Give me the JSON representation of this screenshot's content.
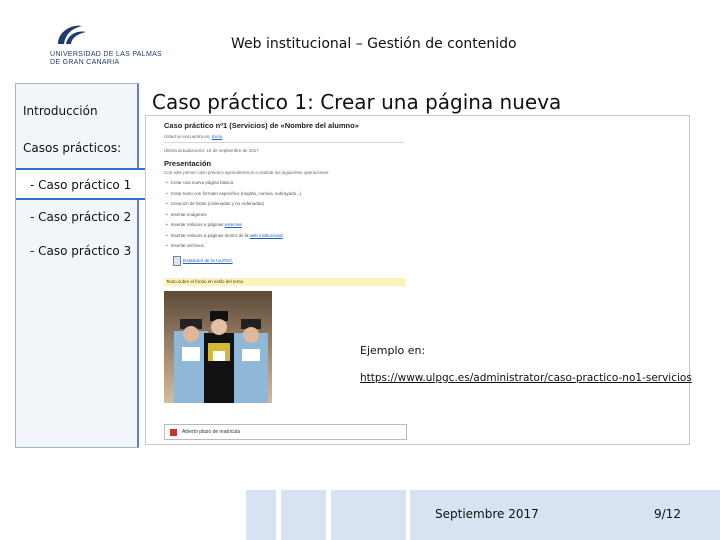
{
  "header": {
    "logo_lines": [
      "UNIVERSIDAD DE LAS PALMAS",
      "DE GRAN CANARIA"
    ],
    "title": "Web institucional – Gestión de contenido"
  },
  "sidebar": {
    "intro": "Introducción",
    "casos_header": "Casos prácticos:",
    "items": [
      {
        "label": "- Caso práctico 1",
        "active": true
      },
      {
        "label": "- Caso práctico 2",
        "active": false
      },
      {
        "label": "- Caso práctico 3",
        "active": false
      }
    ]
  },
  "slide": {
    "title": "Caso práctico 1: Crear una página nueva"
  },
  "screenshot": {
    "heading": "Caso práctico nº1 (Servicios) de «Nombre del alumno»",
    "meta_line1_prefix": "Usted se encuentra en: ",
    "meta_line1_link": "Inicio",
    "meta_line2": "Última actualización: 15 de septiembre de 2017",
    "presentation_heading": "Presentación",
    "presentation_intro": "Con este primer caso práctico aprenderemos a realizar las siguientes operaciones:",
    "list_items": [
      {
        "text": "Crear una nueva página básica",
        "link": ""
      },
      {
        "text": "Crear texto con formato específico (negrita, cursiva, subrayado...)",
        "link": ""
      },
      {
        "text": "Creación de listas (ordenadas y no ordenadas)",
        "link": ""
      },
      {
        "text": "Insertar imágenes",
        "link": ""
      },
      {
        "text": "Insertar enlaces a páginas ",
        "link": "externas"
      },
      {
        "text": "Insertar enlaces a páginas dentro de la ",
        "link": "web institucional"
      },
      {
        "text": "Insertar archivos",
        "link": ""
      }
    ],
    "file_link": "Estatutos de la ULPGC",
    "photo_caption": "Texto sobre el fondo en estilo del tema",
    "alert_text": "Abierto plazo de matrícula"
  },
  "example": {
    "label": "Ejemplo en:",
    "url": "https://www.ulpgc.es/administrator/caso-practico-no1-servicios"
  },
  "footer": {
    "date": "Septiembre 2017",
    "page": "9/12"
  },
  "colors": {
    "sidebar_bg": "#f2f6fb",
    "accent_border": "#2f74c0",
    "footer_blue": "#d7e3f1",
    "link_blue": "#1f5fbf",
    "caption_yellow": "#fdf3b8"
  }
}
